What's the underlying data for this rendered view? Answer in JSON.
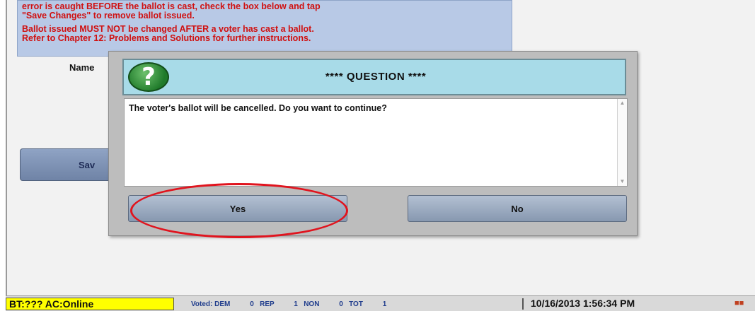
{
  "background": {
    "info_line1": "error is caught BEFORE the ballot is cast, check the box below and tap",
    "info_line2": "\"Save Changes\" to remove ballot issued.",
    "info_line3": "Ballot issued MUST NOT be changed AFTER a voter has cast a ballot.",
    "info_line4": "Refer to Chapter 12: Problems and Solutions for further instructions.",
    "name_label": "Name",
    "save_button_label": "Sav"
  },
  "dialog": {
    "icon": "question-icon",
    "title": "**** QUESTION ****",
    "message": "The voter's ballot will be cancelled.  Do you want to continue?",
    "yes_label": "Yes",
    "no_label": "No"
  },
  "status_bar": {
    "bt_status": "BT:??? AC:Online",
    "voted_label": "Voted:",
    "dem_label": "DEM",
    "dem_count": "0",
    "rep_label": "REP",
    "rep_count": "1",
    "non_label": "NON",
    "non_count": "0",
    "tot_label": "TOT",
    "tot_count": "1",
    "datetime": "10/16/2013 1:56:34 PM"
  },
  "colors": {
    "dialog_header": "#a8dbe8",
    "annotation_ellipse": "#e0141e",
    "status_highlight": "#ffff00"
  }
}
